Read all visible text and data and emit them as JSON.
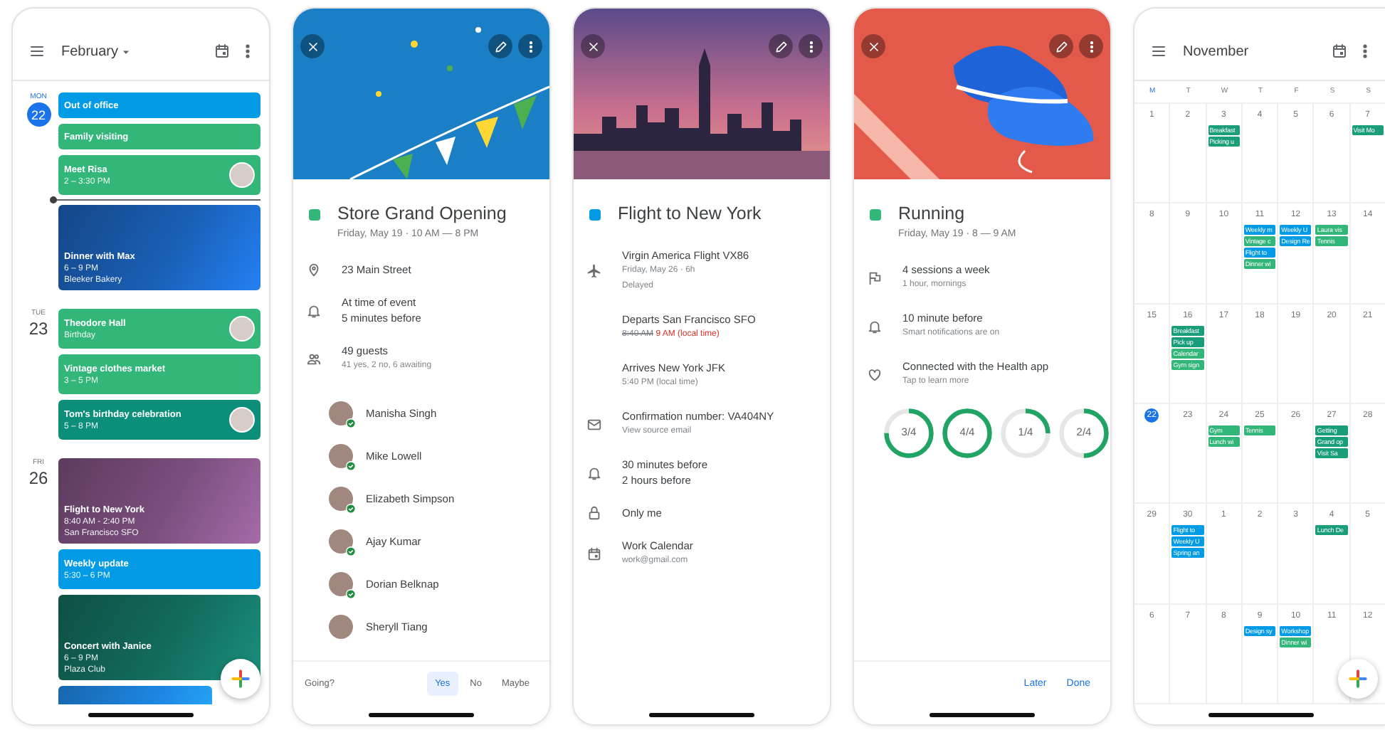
{
  "agenda": {
    "month": "February",
    "days": [
      {
        "weekday": "MON",
        "date": "22",
        "today": true,
        "events": [
          {
            "kind": "plain",
            "title": "Out of office",
            "color": "#039be5",
            "avatar": false,
            "now_after": false
          },
          {
            "kind": "plain",
            "title": "Family visiting",
            "color": "#33b679",
            "avatar": false,
            "now_after": false
          },
          {
            "kind": "timed",
            "title": "Meet Risa",
            "lines": [
              "2 – 3:30 PM"
            ],
            "color": "#33b679",
            "avatar": true,
            "now_after": true
          },
          {
            "kind": "image",
            "title": "Dinner with Max",
            "lines": [
              "6 – 9 PM",
              "Bleeker Bakery"
            ],
            "color": "#1a5fb4",
            "avatar": false,
            "now_after": false
          }
        ]
      },
      {
        "weekday": "TUE",
        "date": "23",
        "today": false,
        "events": [
          {
            "kind": "timed",
            "title": "Theodore Hall",
            "lines": [
              "Birthday"
            ],
            "color": "#33b679",
            "avatar": true,
            "now_after": false
          },
          {
            "kind": "timed",
            "title": "Vintage clothes market",
            "lines": [
              "3 – 5 PM"
            ],
            "color": "#33b679",
            "avatar": false,
            "now_after": false
          },
          {
            "kind": "timed",
            "title": "Tom's birthday celebration",
            "lines": [
              "5 – 8 PM"
            ],
            "color": "#0b8f7a",
            "avatar": true,
            "now_after": false
          }
        ]
      },
      {
        "weekday": "FRI",
        "date": "26",
        "today": false,
        "events": [
          {
            "kind": "image",
            "title": "Flight to New York",
            "lines": [
              "8:40 AM - 2:40 PM",
              "San Francisco SFO"
            ],
            "color": "#7a4f7d",
            "avatar": false,
            "now_after": false
          },
          {
            "kind": "timed",
            "title": "Weekly update",
            "lines": [
              "5:30 – 6 PM"
            ],
            "color": "#039be5",
            "avatar": false,
            "now_after": false
          },
          {
            "kind": "image",
            "title": "Concert with Janice",
            "lines": [
              "6 – 9 PM",
              "Plaza Club"
            ],
            "color": "#136b5c",
            "avatar": false,
            "now_after": false
          },
          {
            "kind": "image",
            "color": "#1e88e5",
            "avatar": false,
            "now_after": false
          }
        ]
      }
    ]
  },
  "store_event": {
    "kind": "bunting",
    "title": "Store Grand Opening",
    "color": "#33b679",
    "when": "Friday, May 19 · 10 AM — 8 PM",
    "rows": [
      {
        "kind": "place",
        "lines": [
          "23 Main Street"
        ]
      },
      {
        "kind": "reminder",
        "lines": [
          "At time of event",
          "5 minutes before"
        ]
      },
      {
        "kind": "guests",
        "lines": [
          "49 guests"
        ],
        "details": [
          "41 yes, 2 no, 6 awaiting"
        ]
      }
    ],
    "guests": [
      {
        "name": "Manisha Singh",
        "accepted": true
      },
      {
        "name": "Mike Lowell",
        "accepted": true
      },
      {
        "name": "Elizabeth Simpson",
        "accepted": true
      },
      {
        "name": "Ajay Kumar",
        "accepted": true
      },
      {
        "name": "Dorian Belknap",
        "accepted": true
      },
      {
        "name": "Sheryll Tiang",
        "accepted": false
      }
    ],
    "rsvp": {
      "prompt": "Going?",
      "options": [
        {
          "label": "Yes",
          "selected": true
        },
        {
          "label": "No",
          "selected": false
        },
        {
          "label": "Maybe",
          "selected": false
        }
      ]
    }
  },
  "flight_event": {
    "kind": "city",
    "title": "Flight to New York",
    "color": "#039be5",
    "rows": [
      {
        "kind": "flight",
        "lines": [
          "Virgin America Flight VX86"
        ],
        "details": [
          "Friday, May 26 · 6h",
          "Delayed"
        ]
      },
      {
        "kind": "departure",
        "lines": [
          "Departs San Francisco SFO"
        ],
        "old_time": "8:40 AM",
        "new_time": "9 AM (local time)"
      },
      {
        "kind": "arrival",
        "lines": [
          "Arrives New York JFK"
        ],
        "details": [
          "5:40 PM (local time)"
        ]
      },
      {
        "kind": "email",
        "lines": [
          "Confirmation number: VA404NY"
        ],
        "details": [
          "View source email"
        ]
      },
      {
        "kind": "reminder",
        "lines": [
          "30 minutes before",
          "2 hours before"
        ]
      },
      {
        "kind": "visibility",
        "lines": [
          "Only me"
        ]
      },
      {
        "kind": "calendar",
        "lines": [
          "Work Calendar"
        ],
        "details": [
          "work@gmail.com"
        ]
      }
    ]
  },
  "running_event": {
    "kind": "sneakers",
    "title": "Running",
    "color": "#33b679",
    "when": "Friday, May 19 · 8 — 9 AM",
    "rows": [
      {
        "kind": "goal",
        "lines": [
          "4 sessions a week"
        ],
        "details": [
          "1 hour, mornings"
        ]
      },
      {
        "kind": "reminder",
        "lines": [
          "10 minute before"
        ],
        "details": [
          "Smart notifications are on"
        ]
      },
      {
        "kind": "health",
        "lines": [
          "Connected with the Health app"
        ],
        "details": [
          "Tap to learn more"
        ]
      }
    ],
    "rings": [
      {
        "label": "3/4",
        "level": 0.75
      },
      {
        "label": "4/4",
        "level": 1
      },
      {
        "label": "1/4",
        "level": 0.25
      },
      {
        "label": "2/4",
        "level": 0.5
      }
    ],
    "actions": [
      "Later",
      "Done"
    ]
  },
  "month_view": {
    "month": "November",
    "weekdays": [
      {
        "label": "M",
        "current": true
      },
      {
        "label": "T",
        "current": false
      },
      {
        "label": "W",
        "current": false
      },
      {
        "label": "T",
        "current": false
      },
      {
        "label": "F",
        "current": false
      },
      {
        "label": "S",
        "current": false
      },
      {
        "label": "S",
        "current": false
      }
    ],
    "weeks": [
      [
        {
          "date": "1",
          "today": false
        },
        {
          "date": "2",
          "today": false
        },
        {
          "date": "3",
          "today": false,
          "events": [
            {
              "title": "Breakfast",
              "color": "#1a9e7a"
            },
            {
              "title": "Picking u",
              "color": "#1a9e7a"
            }
          ]
        },
        {
          "date": "4",
          "today": false
        },
        {
          "date": "5",
          "today": false
        },
        {
          "date": "6",
          "today": false
        },
        {
          "date": "7",
          "today": false,
          "events": [
            {
              "title": "Visit Mo",
              "color": "#1a9e7a"
            }
          ]
        }
      ],
      [
        {
          "date": "8",
          "today": false
        },
        {
          "date": "9",
          "today": false
        },
        {
          "date": "10",
          "today": false
        },
        {
          "date": "11",
          "today": false,
          "events": [
            {
              "title": "Weekly m",
              "color": "#039be5"
            },
            {
              "title": "Vintage c",
              "color": "#33b679"
            },
            {
              "title": "Flight to",
              "color": "#039be5"
            },
            {
              "title": "Dinner wi",
              "color": "#33b679"
            }
          ]
        },
        {
          "date": "12",
          "today": false,
          "events": [
            {
              "title": "Weekly U",
              "color": "#039be5"
            },
            {
              "title": "Design Re",
              "color": "#039be5"
            }
          ]
        },
        {
          "date": "13",
          "today": false,
          "events": [
            {
              "title": "Laura vis",
              "color": "#33b679"
            },
            {
              "title": "Tennis",
              "color": "#33b679"
            }
          ]
        },
        {
          "date": "14",
          "today": false
        }
      ],
      [
        {
          "date": "15",
          "today": false
        },
        {
          "date": "16",
          "today": false,
          "events": [
            {
              "title": "Breakfast",
              "color": "#1a9e7a"
            },
            {
              "title": "Pick up",
              "color": "#1a9e7a"
            },
            {
              "title": "Calendar",
              "color": "#33b679"
            },
            {
              "title": "Gym sign",
              "color": "#33b679"
            }
          ]
        },
        {
          "date": "17",
          "today": false
        },
        {
          "date": "18",
          "today": false
        },
        {
          "date": "19",
          "today": false
        },
        {
          "date": "20",
          "today": false
        },
        {
          "date": "21",
          "today": false
        }
      ],
      [
        {
          "date": "22",
          "today": true
        },
        {
          "date": "23",
          "today": false
        },
        {
          "date": "24",
          "today": false,
          "events": [
            {
              "title": "Gym",
              "color": "#33b679"
            },
            {
              "title": "Lunch wi",
              "color": "#33b679"
            }
          ]
        },
        {
          "date": "25",
          "today": false,
          "events": [
            {
              "title": "Tennis",
              "color": "#33b679"
            }
          ]
        },
        {
          "date": "26",
          "today": false
        },
        {
          "date": "27",
          "today": false,
          "events": [
            {
              "title": "Getting",
              "color": "#1a9e7a"
            },
            {
              "title": "Grand op",
              "color": "#1a9e7a"
            },
            {
              "title": "Visit Sa",
              "color": "#1a9e7a"
            }
          ]
        },
        {
          "date": "28",
          "today": false
        }
      ],
      [
        {
          "date": "29",
          "today": false
        },
        {
          "date": "30",
          "today": false,
          "events": [
            {
              "title": "Flight to",
              "color": "#039be5"
            },
            {
              "title": "Weekly U",
              "color": "#039be5"
            },
            {
              "title": "Spring an",
              "color": "#039be5"
            }
          ]
        },
        {
          "date": "1",
          "today": false
        },
        {
          "date": "2",
          "today": false
        },
        {
          "date": "3",
          "today": false
        },
        {
          "date": "4",
          "today": false,
          "events": [
            {
              "title": "Lunch De",
              "color": "#1a9e7a"
            }
          ]
        },
        {
          "date": "5",
          "today": false
        }
      ],
      [
        {
          "date": "6",
          "today": false
        },
        {
          "date": "7",
          "today": false
        },
        {
          "date": "8",
          "today": false
        },
        {
          "date": "9",
          "today": false,
          "events": [
            {
              "title": "Design sy",
              "color": "#039be5"
            }
          ]
        },
        {
          "date": "10",
          "today": false,
          "events": [
            {
              "title": "Workshop",
              "color": "#039be5"
            },
            {
              "title": "Dinner wi",
              "color": "#33b679"
            }
          ]
        },
        {
          "date": "11",
          "today": false
        },
        {
          "date": "12",
          "today": false
        }
      ]
    ]
  }
}
